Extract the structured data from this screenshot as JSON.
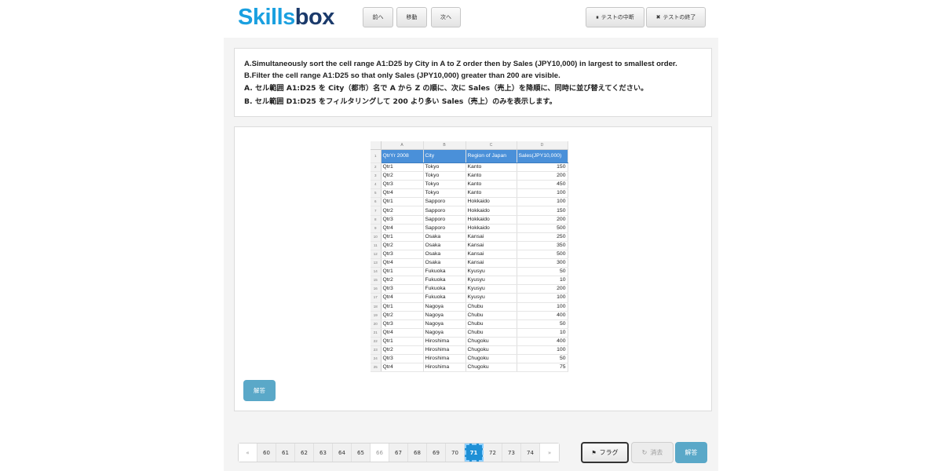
{
  "brand": {
    "part1": "Skills",
    "part2": "box"
  },
  "toolbar": {
    "prev_label": "前へ",
    "move_label": "移動",
    "next_label": "次へ",
    "pause_label": "テストの中断",
    "end_label": "テストの終了"
  },
  "question": {
    "line_a_en": "A.Simultaneously sort the cell range A1:D25 by City in A to Z order then by Sales (JPY10,000) in largest to smallest order.",
    "line_b_en": "B.Filter the cell range A1:D25 so that only Sales (JPY10,000) greater than 200 are visible.",
    "line_a_jp": "A. セル範囲 A1:D25 を City（都市）名で A から Z の順に、次に Sales（売上）を降順に、同時に並び替えてください。",
    "line_b_jp": "B. セル範囲 D1:D25 をフィルタリングして 200 より多い Sales（売上）のみを表示します。"
  },
  "spreadsheet": {
    "col_letters": [
      "A",
      "B",
      "C",
      "D"
    ],
    "headers": [
      "QtrYr 2008",
      "City",
      "Region of Japan",
      "Sales(JPY10,000)"
    ],
    "rows": [
      [
        "Qtr1",
        "Tokyo",
        "Kanto",
        "150"
      ],
      [
        "Qtr2",
        "Tokyo",
        "Kanto",
        "200"
      ],
      [
        "Qtr3",
        "Tokyo",
        "Kanto",
        "450"
      ],
      [
        "Qtr4",
        "Tokyo",
        "Kanto",
        "100"
      ],
      [
        "Qtr1",
        "Sapporo",
        "Hokkaido",
        "100"
      ],
      [
        "Qtr2",
        "Sapporo",
        "Hokkaido",
        "150"
      ],
      [
        "Qtr3",
        "Sapporo",
        "Hokkaido",
        "200"
      ],
      [
        "Qtr4",
        "Sapporo",
        "Hokkaido",
        "500"
      ],
      [
        "Qtr1",
        "Osaka",
        "Kansai",
        "250"
      ],
      [
        "Qtr2",
        "Osaka",
        "Kansai",
        "350"
      ],
      [
        "Qtr3",
        "Osaka",
        "Kansai",
        "500"
      ],
      [
        "Qtr4",
        "Osaka",
        "Kansai",
        "300"
      ],
      [
        "Qtr1",
        "Fukuoka",
        "Kyusyu",
        "50"
      ],
      [
        "Qtr2",
        "Fukuoka",
        "Kyusyu",
        "10"
      ],
      [
        "Qtr3",
        "Fukuoka",
        "Kyusyu",
        "200"
      ],
      [
        "Qtr4",
        "Fukuoka",
        "Kyusyu",
        "100"
      ],
      [
        "Qtr1",
        "Nagoya",
        "Chubu",
        "100"
      ],
      [
        "Qtr2",
        "Nagoya",
        "Chubu",
        "400"
      ],
      [
        "Qtr3",
        "Nagoya",
        "Chubu",
        "50"
      ],
      [
        "Qtr4",
        "Nagoya",
        "Chubu",
        "10"
      ],
      [
        "Qtr1",
        "Hiroshima",
        "Chugoku",
        "400"
      ],
      [
        "Qtr2",
        "Hiroshima",
        "Chugoku",
        "100"
      ],
      [
        "Qtr3",
        "Hiroshima",
        "Chugoku",
        "50"
      ],
      [
        "Qtr4",
        "Hiroshima",
        "Chugoku",
        "75"
      ]
    ]
  },
  "answer_small_label": "解答",
  "pagination": {
    "prev": "«",
    "next": "»",
    "pages": [
      "60",
      "61",
      "62",
      "63",
      "64",
      "65",
      "66",
      "67",
      "68",
      "69",
      "70",
      "71",
      "72",
      "73",
      "74"
    ],
    "current": "71",
    "plain_page": "66"
  },
  "footer": {
    "flag_label": "フラグ",
    "clear_label": "消去",
    "answer_label": "解答"
  },
  "colors": {
    "brand_light": "#1aa0e0",
    "brand_dark": "#1b3a6b",
    "header_row": "#4a90d9",
    "answer_button": "#5aa8c8",
    "active_page": "#1e90d6"
  }
}
